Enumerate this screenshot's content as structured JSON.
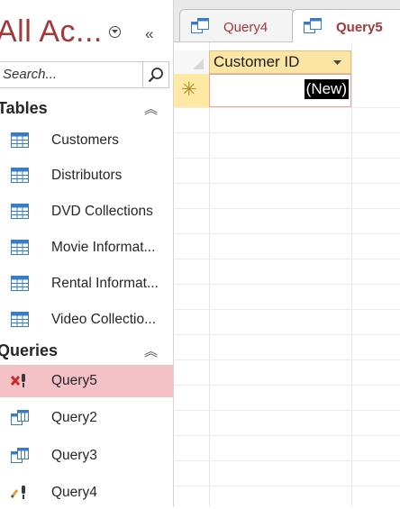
{
  "nav": {
    "title": "All Ac...",
    "search_placeholder": "Search...",
    "groups": {
      "tables": {
        "label": "Tables",
        "items": [
          {
            "label": "Customers",
            "icon": "table-icon"
          },
          {
            "label": "Distributors",
            "icon": "table-icon"
          },
          {
            "label": "DVD Collections",
            "icon": "table-icon"
          },
          {
            "label": "Movie Informat...",
            "icon": "table-icon"
          },
          {
            "label": "Rental Informat...",
            "icon": "table-icon"
          },
          {
            "label": "Video Collectio...",
            "icon": "table-icon"
          }
        ]
      },
      "queries": {
        "label": "Queries",
        "items": [
          {
            "label": "Query5",
            "icon": "delete-query-icon",
            "selected": true
          },
          {
            "label": "Query2",
            "icon": "select-query-icon"
          },
          {
            "label": "Query3",
            "icon": "select-query-icon"
          },
          {
            "label": "Query4",
            "icon": "update-query-icon"
          }
        ]
      }
    }
  },
  "tabs": [
    {
      "label": "Query4",
      "active": false
    },
    {
      "label": "Query5",
      "active": true
    }
  ],
  "datasheet": {
    "column_header": "Customer ID",
    "new_row_marker": "✳",
    "new_row_value": "(New)"
  },
  "colors": {
    "accent": "#a4373a",
    "selected_item": "#f4c2c6",
    "column_header_bg": "#fce4a2"
  }
}
